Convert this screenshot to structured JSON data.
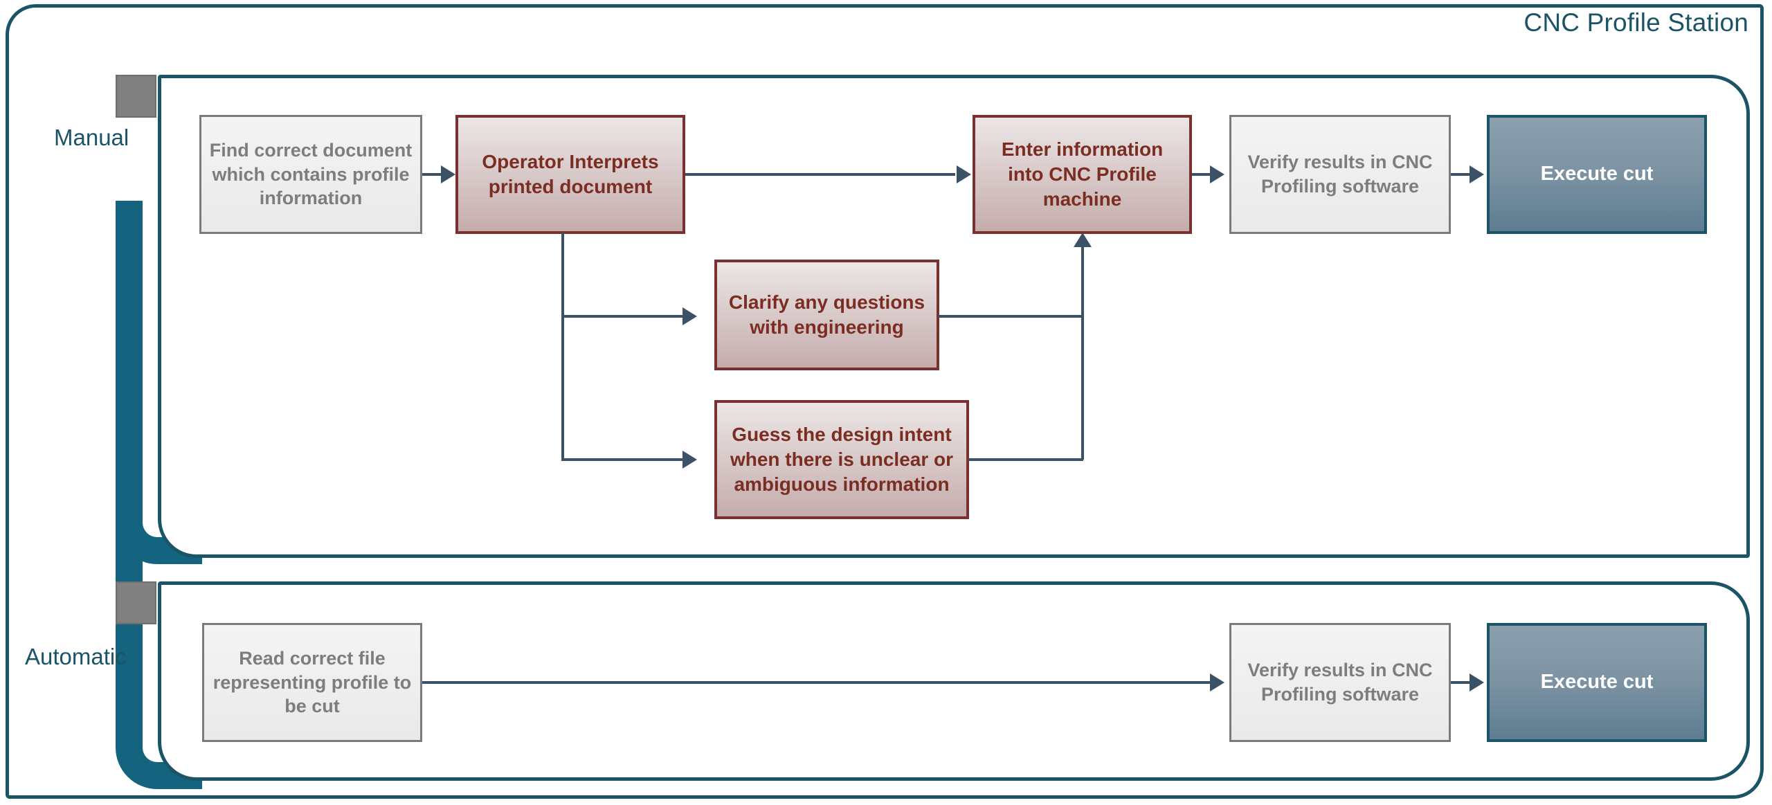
{
  "diagram": {
    "title": "CNC Profile Station",
    "accent_color": "#1b5467",
    "lane_bracket_color": "#14647f",
    "tab_color": "#808080",
    "connector_color": "#3b5266"
  },
  "lanes": [
    {
      "id": "manual",
      "label": "Manual",
      "nodes": [
        {
          "id": "find-document",
          "label": "Find correct document which contains profile information",
          "style": "gray"
        },
        {
          "id": "operator-interprets",
          "label": "Operator Interprets printed document",
          "style": "maroon"
        },
        {
          "id": "clarify-questions",
          "label": "Clarify any questions with engineering",
          "style": "maroon"
        },
        {
          "id": "guess-design-intent",
          "label": "Guess the design intent when there is unclear or ambiguous information",
          "style": "maroon"
        },
        {
          "id": "enter-information",
          "label": "Enter information into CNC Profile machine",
          "style": "maroon"
        },
        {
          "id": "verify-results",
          "label": "Verify results in CNC Profiling software",
          "style": "gray"
        },
        {
          "id": "execute-cut",
          "label": "Execute cut",
          "style": "steel"
        }
      ],
      "flows": [
        "find-document -> operator-interprets",
        "operator-interprets -> enter-information",
        "operator-interprets -> clarify-questions",
        "operator-interprets -> guess-design-intent",
        "clarify-questions -> enter-information",
        "guess-design-intent -> enter-information",
        "enter-information -> verify-results",
        "verify-results -> execute-cut"
      ]
    },
    {
      "id": "automatic",
      "label": "Automatic",
      "nodes": [
        {
          "id": "read-file",
          "label": "Read correct file representing profile to be cut",
          "style": "gray"
        },
        {
          "id": "verify-results-auto",
          "label": "Verify results in CNC Profiling software",
          "style": "gray"
        },
        {
          "id": "execute-cut-auto",
          "label": "Execute cut",
          "style": "steel"
        }
      ],
      "flows": [
        "read-file -> verify-results-auto",
        "verify-results-auto -> execute-cut-auto"
      ]
    }
  ]
}
